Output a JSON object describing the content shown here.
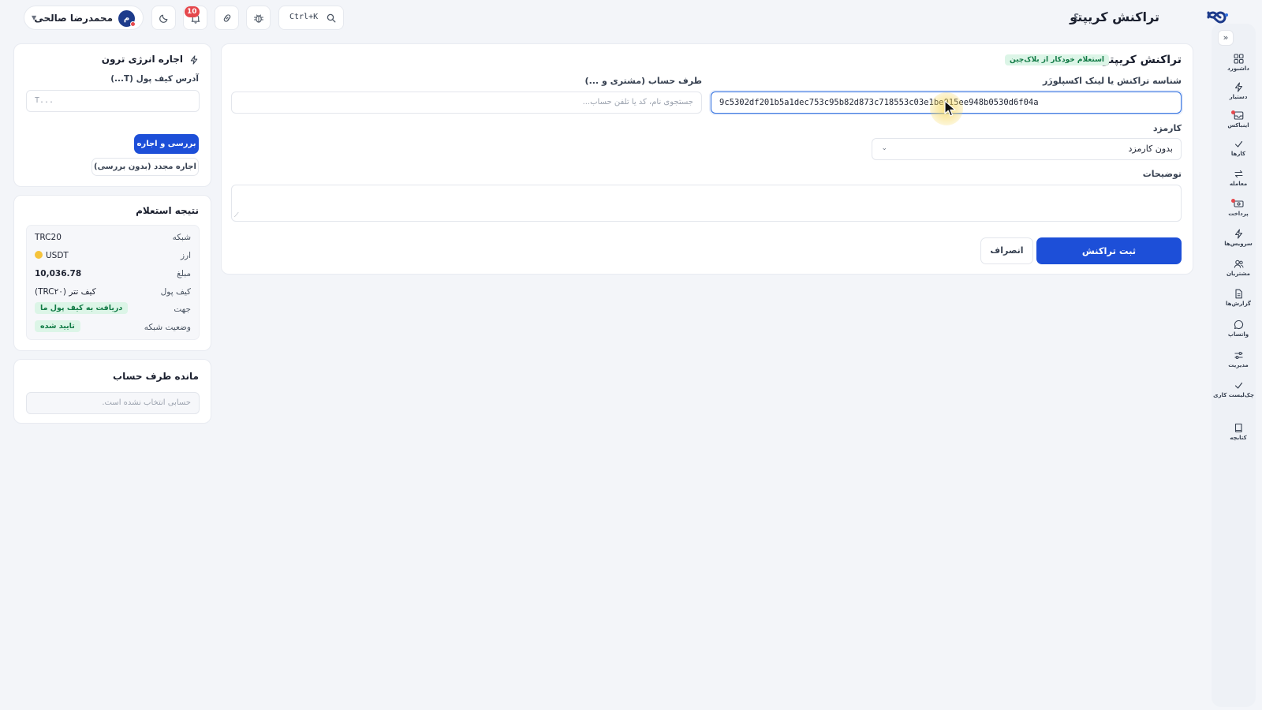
{
  "header": {
    "title": "تراکنش کریپتو",
    "help": "؟",
    "user_name": "محمدرضا صالحی",
    "avatar_initial": "م",
    "notifications_count": "10",
    "search_shortcut": "Ctrl+K"
  },
  "rail": {
    "collapse_glyph": "»",
    "items": [
      {
        "label": "داشبورد",
        "icon": "grid-icon"
      },
      {
        "label": "دستیار",
        "icon": "bolt-icon"
      },
      {
        "label": "اینباکس",
        "icon": "inbox-icon"
      },
      {
        "label": "کارها",
        "icon": "check-icon"
      },
      {
        "label": "معامله",
        "icon": "swap-icon"
      },
      {
        "label": "پرداخت",
        "icon": "cash-icon"
      },
      {
        "label": "سرویس‌ها",
        "icon": "bolt-icon"
      },
      {
        "label": "مشتریان",
        "icon": "users-icon"
      },
      {
        "label": "گزارش‌ها",
        "icon": "file-icon"
      },
      {
        "label": "واتساپ",
        "icon": "chat-icon"
      },
      {
        "label": "مدیریت",
        "icon": "sliders-icon"
      },
      {
        "label": "چک‌لیست کاری",
        "icon": "check-icon"
      },
      {
        "label": "کتابچه",
        "icon": "book-icon"
      }
    ]
  },
  "form": {
    "title": "تراکنش کریپتو",
    "auto_badge": "استعلام خودکار از بلاک‌چین",
    "txid_label": "شناسه تراکنش یا لینک اکسپلورر",
    "txid_help": "؟",
    "txid_value": "9c5302df201b5a1dec753c95b82d873c718553c03e1be015ee948b0530d6f04a",
    "party_label": "طرف حساب (مشتری و ...)",
    "party_placeholder": "جستجوی نام، کد یا تلفن حساب...",
    "fee_label": "کارمزد",
    "fee_value": "بدون کارمزد",
    "notes_label": "توضیحات",
    "submit_label": "ثبت تراکنش",
    "cancel_label": "انصراف"
  },
  "energy": {
    "title": "اجاره انرژی ترون",
    "address_label": "آدرس کیف پول (T...)",
    "address_placeholder": "T...",
    "check_rent_label": "بررسی و اجاره",
    "re_rent_label": "اجاره مجدد (بدون بررسی)"
  },
  "result": {
    "title": "نتیجه استعلام",
    "rows": [
      {
        "key": "شبکه",
        "value": "TRC20"
      },
      {
        "key": "ارز",
        "value": "USDT"
      },
      {
        "key": "مبلغ",
        "value": "10,036.78"
      },
      {
        "key": "کیف پول",
        "value": "کیف تتر (TRC۲۰)"
      },
      {
        "key": "جهت",
        "value": "دریافت به کیف پول ما"
      },
      {
        "key": "وضعیت شبکه",
        "value": "تایید شده"
      }
    ]
  },
  "balance": {
    "title": "مانده طرف حساب",
    "empty_text": "حسابی انتخاب نشده است."
  },
  "colors": {
    "primary": "#1d4fd8",
    "success_bg": "#dcf5e7",
    "success_text": "#117a45",
    "danger": "#e5484d",
    "page_bg": "#f3f5f9"
  }
}
